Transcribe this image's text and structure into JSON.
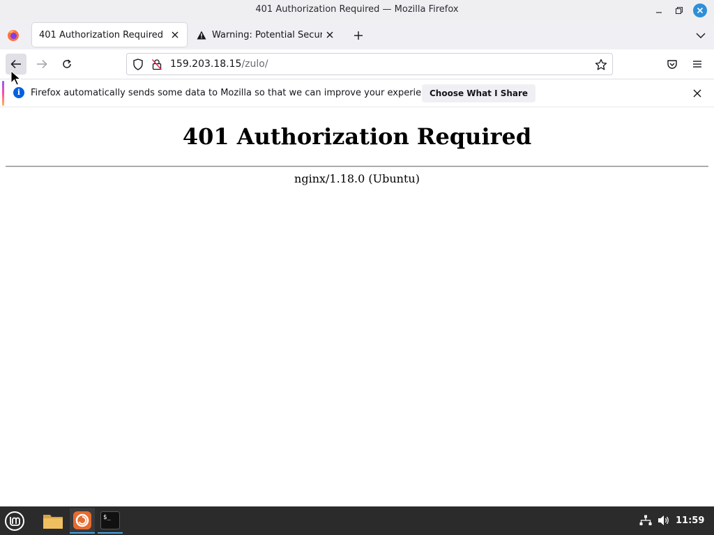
{
  "window": {
    "title": "401 Authorization Required — Mozilla Firefox"
  },
  "tabs": [
    {
      "label": "401 Authorization Required",
      "active": true
    },
    {
      "label": "Warning: Potential Security Risk Ahead",
      "active": false,
      "icon": "warning-icon"
    }
  ],
  "navbar": {
    "url_host": "159.203.18.15",
    "url_path": "/zulo/"
  },
  "notification": {
    "message": "Firefox automatically sends some data to Mozilla so that we can improve your experience.",
    "button_label": "Choose What I Share"
  },
  "page": {
    "heading": "401 Authorization Required",
    "server": "nginx/1.18.0 (Ubuntu)"
  },
  "taskbar": {
    "clock": "11:59",
    "apps": [
      "files-icon",
      "firefox-icon",
      "terminal-icon"
    ]
  },
  "colors": {
    "accent": "#0060df",
    "taskbar": "#2b2b2b",
    "close_button": "#2e8fd8"
  }
}
